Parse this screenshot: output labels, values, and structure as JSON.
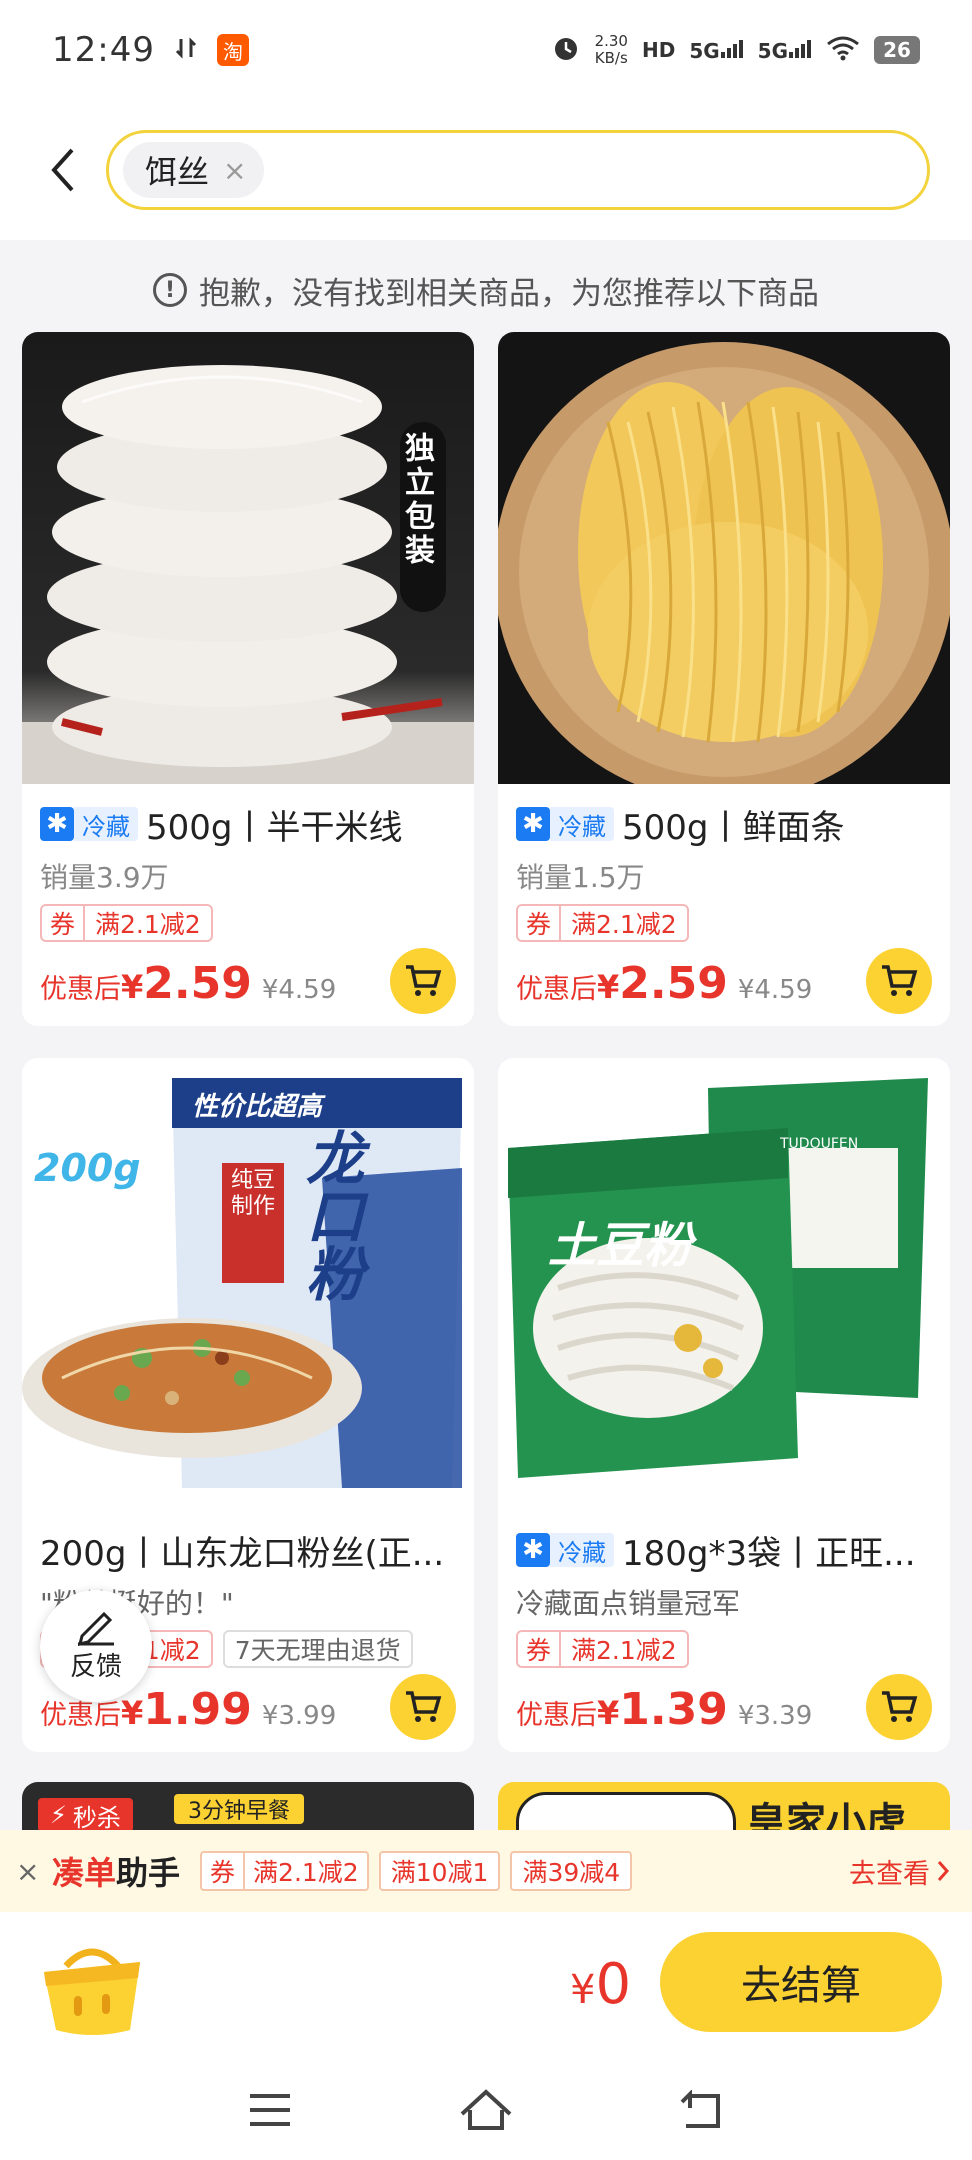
{
  "status_bar": {
    "time": "12:49",
    "app_badge": "淘",
    "net_speed_value": "2.30",
    "net_speed_unit": "KB/s",
    "hd_label": "HD",
    "signal1": "5G",
    "signal2": "5G",
    "battery": "26"
  },
  "search": {
    "keyword": "饵丝",
    "clear_symbol": "×"
  },
  "notice": {
    "icon_text": "!",
    "text": "抱歉，没有找到相关商品，为您推荐以下商品"
  },
  "products": [
    {
      "cold_label": "冷藏",
      "title": "500g丨半干米线",
      "subtitle": "销量3.9万",
      "coupon_label": "券",
      "coupon_value": "满2.1减2",
      "price_label": "优惠后",
      "currency": "¥",
      "price": "2.59",
      "original_price": "¥4.59",
      "image_text": "独立包装"
    },
    {
      "cold_label": "冷藏",
      "title": "500g丨鲜面条",
      "subtitle": "销量1.5万",
      "coupon_label": "券",
      "coupon_value": "满2.1减2",
      "price_label": "优惠后",
      "currency": "¥",
      "price": "2.59",
      "original_price": "¥4.59"
    },
    {
      "title": "200g丨山东龙口粉丝(正...",
      "subtitle": "\"粉丝挺好的！\"",
      "coupon_label": "券",
      "coupon_value": "满2.1减2",
      "extra_tag": "7天无理由退货",
      "price_label": "优惠后",
      "currency": "¥",
      "price": "1.99",
      "original_price": "¥3.99",
      "image_weight": "200g",
      "image_banner": "性价比超高",
      "image_brand": "龙口粉",
      "image_side": "纯豆制作"
    },
    {
      "cold_label": "冷藏",
      "title": "180g*3袋丨正旺...",
      "subtitle": "冷藏面点销量冠军",
      "coupon_label": "券",
      "coupon_value": "满2.1减2",
      "price_label": "优惠后",
      "currency": "¥",
      "price": "1.39",
      "original_price": "¥3.39",
      "image_brand": "土豆粉",
      "image_pinyin": "TUDOUFEN"
    }
  ],
  "peek_cards": {
    "left_tag": "秒杀",
    "left_label": "3分钟早餐",
    "right_text": "皇家小虎"
  },
  "feedback": {
    "label": "反馈"
  },
  "assistant_bar": {
    "close_symbol": "×",
    "title_highlight": "凑单",
    "title_rest": "助手",
    "coupon_label": "券",
    "coupons": [
      "满2.1减2",
      "满10减1",
      "满39减4"
    ],
    "go_see": "去查看"
  },
  "checkout": {
    "currency": "¥",
    "total": "0",
    "button": "去结算"
  },
  "colors": {
    "accent_yellow": "#fcd232",
    "price_red": "#e8352c",
    "cold_blue": "#1b7bf2"
  }
}
